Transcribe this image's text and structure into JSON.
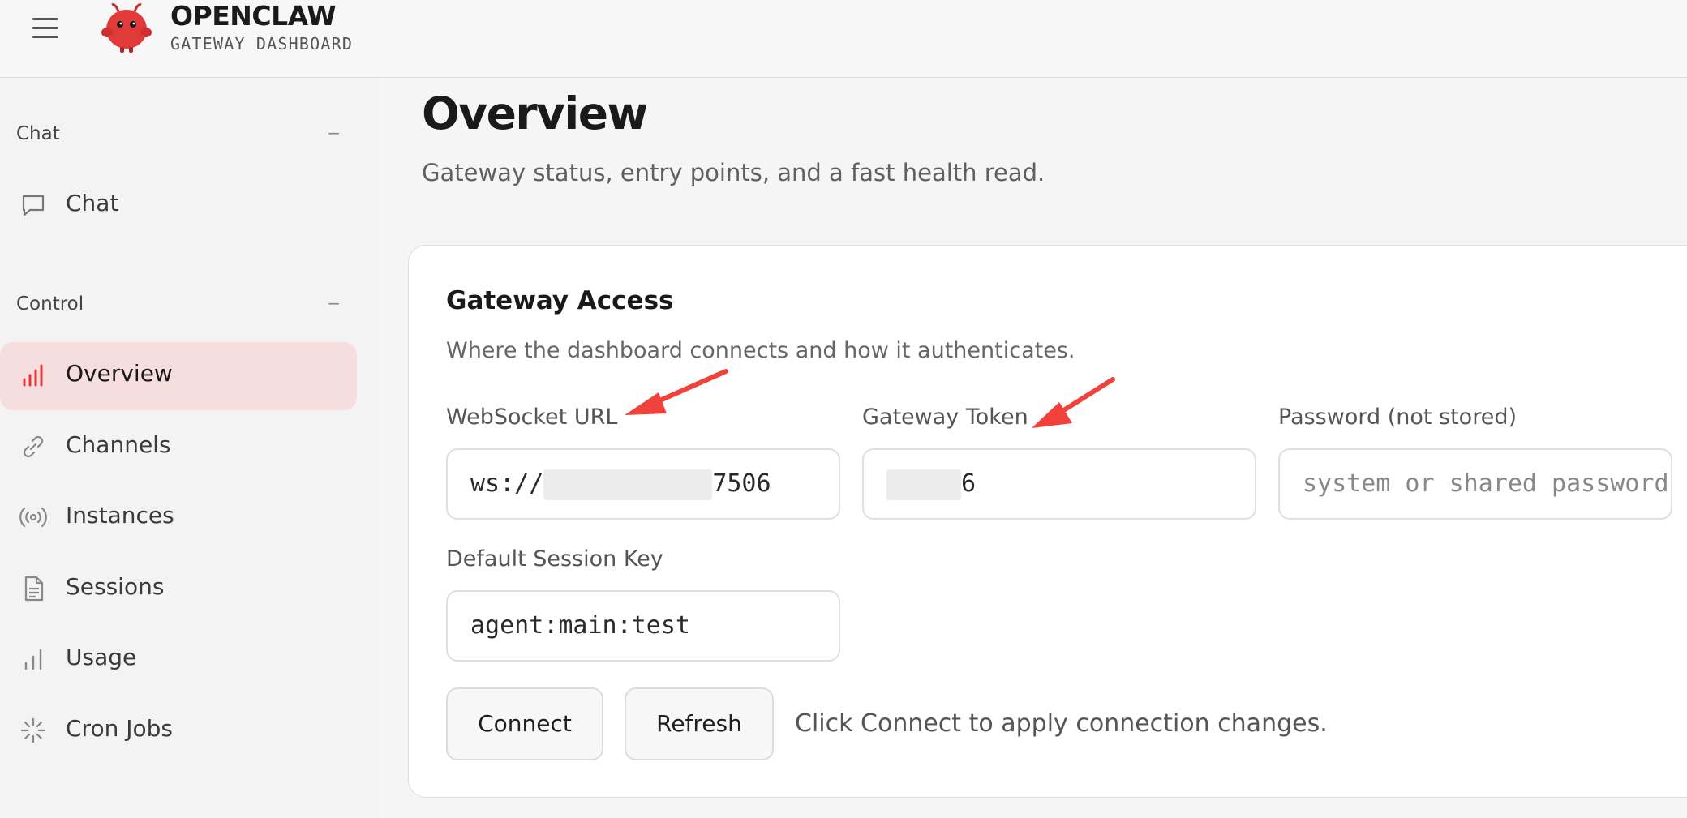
{
  "header": {
    "brand_title": "OPENCLAW",
    "brand_subtitle": "GATEWAY DASHBOARD",
    "menu_icon": "hamburger-icon",
    "logo_icon": "red-mascot-logo"
  },
  "sidebar": {
    "sections": [
      {
        "label": "Chat",
        "collapse": "−",
        "items": [
          {
            "label": "Chat",
            "icon": "chat-bubble-icon",
            "active": false
          }
        ]
      },
      {
        "label": "Control",
        "collapse": "−",
        "items": [
          {
            "label": "Overview",
            "icon": "bar-chart-icon",
            "active": true
          },
          {
            "label": "Channels",
            "icon": "link-icon",
            "active": false
          },
          {
            "label": "Instances",
            "icon": "radio-broadcast-icon",
            "active": false
          },
          {
            "label": "Sessions",
            "icon": "document-icon",
            "active": false
          },
          {
            "label": "Usage",
            "icon": "bar-chart-icon",
            "active": false
          },
          {
            "label": "Cron Jobs",
            "icon": "loader-icon",
            "active": false
          }
        ]
      }
    ]
  },
  "main": {
    "title": "Overview",
    "subtitle": "Gateway status, entry points, and a fast health read.",
    "card": {
      "title": "Gateway Access",
      "subtitle": "Where the dashboard connects and how it authenticates.",
      "fields": {
        "websocket_url": {
          "label": "WebSocket URL",
          "value_prefix": "ws://",
          "value_suffix": "7506"
        },
        "gateway_token": {
          "label": "Gateway Token",
          "value_suffix": "6"
        },
        "password": {
          "label": "Password (not stored)",
          "placeholder": "system or shared password"
        },
        "session_key": {
          "label": "Default Session Key",
          "value": "agent:main:test"
        }
      },
      "buttons": {
        "connect": "Connect",
        "refresh": "Refresh"
      },
      "hint": "Click Connect to apply connection changes."
    }
  },
  "colors": {
    "accent": "#e03a3a",
    "active_bg": "#f7dede",
    "annotation_arrow": "#f0413a"
  }
}
